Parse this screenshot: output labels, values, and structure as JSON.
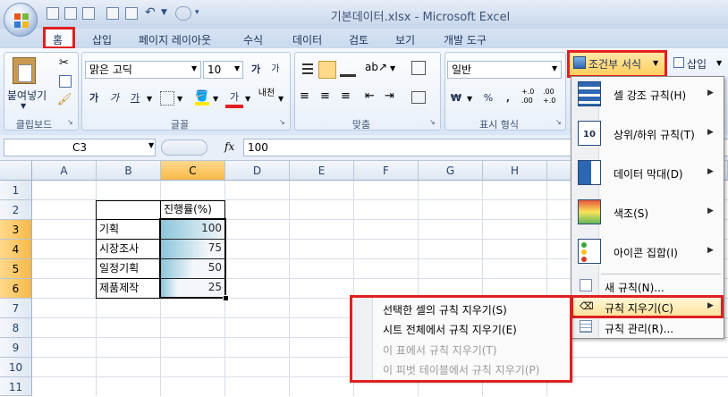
{
  "window": {
    "title": "기본데이터.xlsx - Microsoft Excel"
  },
  "tabs": [
    "홈",
    "삽입",
    "페이지 레이아웃",
    "수식",
    "데이터",
    "검토",
    "보기",
    "개발 도구"
  ],
  "ribbon": {
    "clipboard": {
      "paste_label": "붙여넣기",
      "group_label": "클립보드"
    },
    "font": {
      "family": "맑은 고딕",
      "size": "10",
      "grow": "가",
      "shrink": "가",
      "bold": "가",
      "italic": "가",
      "underline": "가",
      "font_color_glyph": "가",
      "phonetic": "내천",
      "group_label": "글꼴"
    },
    "alignment": {
      "group_label": "맞춤"
    },
    "number": {
      "format": "일반",
      "currency": "₩",
      "percent": "%",
      "comma": ",",
      "inc_decimal": "+.0 .00",
      "dec_decimal": ".00 +.0",
      "group_label": "표시 형식"
    },
    "conditional_format_label": "조건부 서식",
    "insert_label": "삽입"
  },
  "formula_bar": {
    "name_box": "C3",
    "fx": "fx",
    "value": "100"
  },
  "columns": [
    "A",
    "B",
    "C",
    "D",
    "E",
    "F",
    "G",
    "H"
  ],
  "rows": [
    "1",
    "2",
    "3",
    "4",
    "5",
    "6",
    "7",
    "8",
    "9",
    "10",
    "11"
  ],
  "table": {
    "header": "진행률(%)",
    "rows": [
      {
        "name": "기획",
        "value": "100",
        "pct": 1.0
      },
      {
        "name": "시장조사",
        "value": "75",
        "pct": 0.75
      },
      {
        "name": "일정기획",
        "value": "50",
        "pct": 0.5
      },
      {
        "name": "제품제작",
        "value": "25",
        "pct": 0.25
      }
    ]
  },
  "cf_menu": {
    "items": [
      {
        "label": "셀 강조 규칙(H)",
        "icon": "highlight-rules-icon"
      },
      {
        "label": "상위/하위 규칙(T)",
        "icon": "top-bottom-rules-icon"
      },
      {
        "label": "데이터 막대(D)",
        "icon": "data-bars-icon"
      },
      {
        "label": "색조(S)",
        "icon": "color-scales-icon"
      },
      {
        "label": "아이콘 집합(I)",
        "icon": "icon-sets-icon"
      }
    ],
    "new_rule": "새 규칙(N)...",
    "clear_rules": "규칙 지우기(C)",
    "manage_rules": "규칙 관리(R)..."
  },
  "clear_submenu": {
    "items": [
      {
        "label": "선택한 셀의 규칙 지우기(S)",
        "enabled": true
      },
      {
        "label": "시트 전체에서 규칙 지우기(E)",
        "enabled": true
      },
      {
        "label": "이 표에서 규칙 지우기(T)",
        "enabled": false
      },
      {
        "label": "이 피벗 테이블에서 규칙 지우기(P)",
        "enabled": false
      }
    ]
  },
  "colors": {
    "highlight_red": "#e02020",
    "bar_fill": "#82c4d8",
    "selection": "#f8b94a"
  }
}
